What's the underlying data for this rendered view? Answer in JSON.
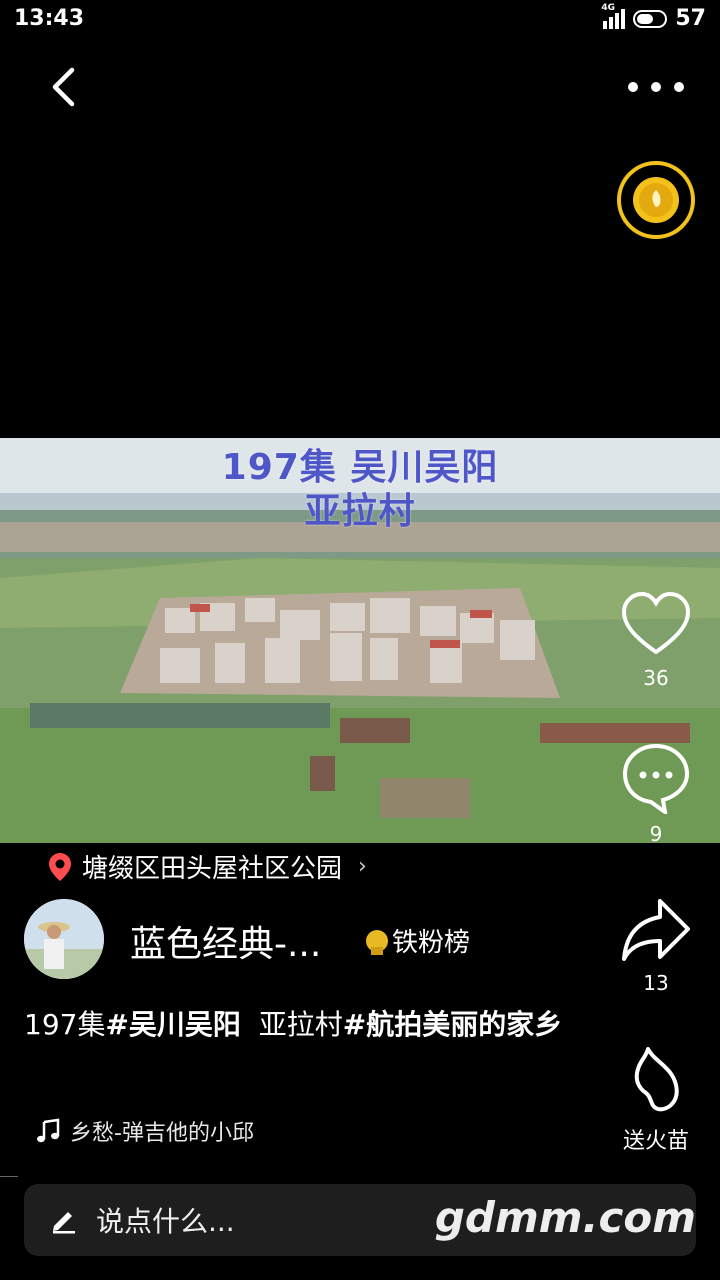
{
  "status_bar": {
    "time": "13:43",
    "network": "4G",
    "battery": "57"
  },
  "video": {
    "title_line1": "197集 吴川吴阳",
    "title_line2": "亚拉村"
  },
  "actions": {
    "like_count": "36",
    "comment_count": "9",
    "share_count": "13",
    "gift_label": "送火苗"
  },
  "location": {
    "text": "塘缀区田头屋社区公园"
  },
  "author": {
    "name": "蓝色经典-...",
    "fans_label": "铁粉榜"
  },
  "caption": {
    "part1": "197集",
    "tag1": "#吴川吴阳",
    "part2": "  亚拉村",
    "tag2": "#航拍美丽的家乡"
  },
  "music": {
    "text": "乡愁-弹吉他的小邱"
  },
  "comment": {
    "placeholder": "说点什么..."
  },
  "watermark": "gdmm.com",
  "colors": {
    "title_blue": "#4e56c8",
    "coin_gold": "#f2c21b",
    "location_pin": "#ff4d4f"
  }
}
